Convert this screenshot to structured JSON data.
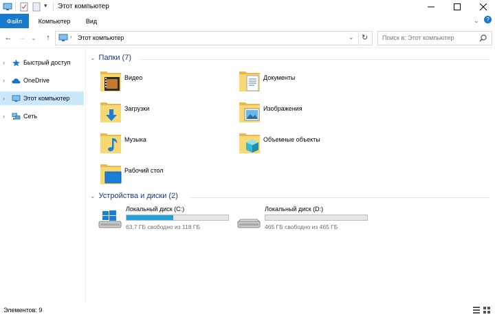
{
  "window": {
    "title": "Этот компьютер",
    "controls": [
      "minimize",
      "maximize",
      "close"
    ]
  },
  "ribbon": {
    "tabs": [
      {
        "label": "Файл",
        "active": true
      },
      {
        "label": "Компьютер"
      },
      {
        "label": "Вид"
      }
    ]
  },
  "address": {
    "path": "Этот компьютер",
    "search_placeholder": "Поиск в: Этот компьютер"
  },
  "nav": {
    "items": [
      {
        "label": "Быстрый доступ",
        "icon": "star-icon"
      },
      {
        "label": "OneDrive",
        "icon": "cloud-icon"
      },
      {
        "label": "Этот компьютер",
        "icon": "computer-icon",
        "selected": true
      },
      {
        "label": "Сеть",
        "icon": "network-icon"
      }
    ]
  },
  "folders_group": {
    "title": "Папки (7)",
    "items": [
      {
        "label": "Видео",
        "icon": "video-folder-icon"
      },
      {
        "label": "Документы",
        "icon": "documents-folder-icon"
      },
      {
        "label": "Загрузки",
        "icon": "downloads-folder-icon"
      },
      {
        "label": "Изображения",
        "icon": "pictures-folder-icon"
      },
      {
        "label": "Музыка",
        "icon": "music-folder-icon"
      },
      {
        "label": "Объемные объекты",
        "icon": "3d-objects-folder-icon"
      },
      {
        "label": "Рабочий стол",
        "icon": "desktop-folder-icon"
      }
    ]
  },
  "drives_group": {
    "title": "Устройства и диски (2)",
    "items": [
      {
        "label": "Локальный диск (C:)",
        "free_text": "63,7 ГБ свободно из 118 ГБ",
        "used_fraction": 0.46,
        "icon": "windows-drive-icon"
      },
      {
        "label": "Локальный диск (D:)",
        "free_text": "465 ГБ свободно из 465 ГБ",
        "used_fraction": 0.0,
        "icon": "drive-icon"
      }
    ]
  },
  "status": {
    "items_text": "Элементов: 9"
  },
  "colors": {
    "accent": "#1979ca",
    "selection": "#cce8ff",
    "group_header": "#1e3287",
    "bar_fill": "#26a0da",
    "folder_yellow": "#f8d775"
  }
}
